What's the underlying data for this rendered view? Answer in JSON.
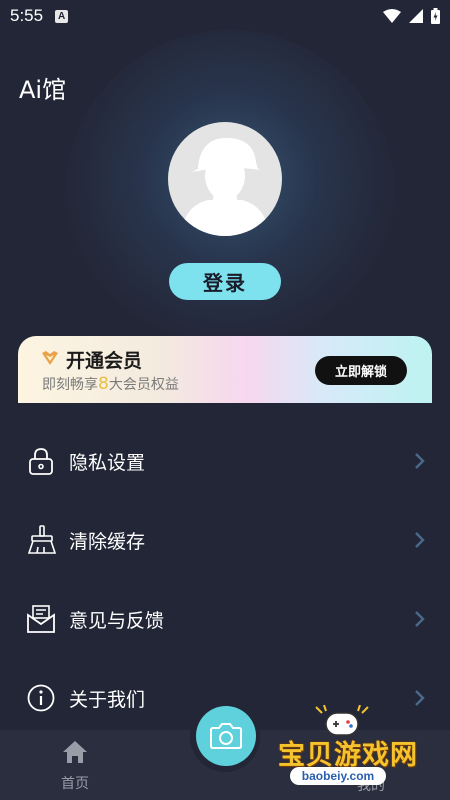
{
  "status_bar": {
    "time": "5:55",
    "notification_letter": "A"
  },
  "app": {
    "title": "Ai馆"
  },
  "profile": {
    "login_label": "登录"
  },
  "vip": {
    "title": "开通会员",
    "subtitle_prefix": "即刻畅享",
    "subtitle_number": "8",
    "subtitle_suffix": "大会员权益",
    "unlock_label": "立即解锁"
  },
  "menu": {
    "items": [
      {
        "label": "隐私设置",
        "icon": "lock-icon"
      },
      {
        "label": "清除缓存",
        "icon": "broom-icon"
      },
      {
        "label": "意见与反馈",
        "icon": "feedback-mail-icon"
      },
      {
        "label": "关于我们",
        "icon": "info-icon"
      }
    ]
  },
  "bottom_nav": {
    "home_label": "首页",
    "mine_label": "我的"
  },
  "watermark": {
    "title": "宝贝游戏网",
    "url": "baobeiy.com"
  },
  "colors": {
    "background": "#232636",
    "accent": "#7ee1ee",
    "camera": "#5ed1dd"
  }
}
